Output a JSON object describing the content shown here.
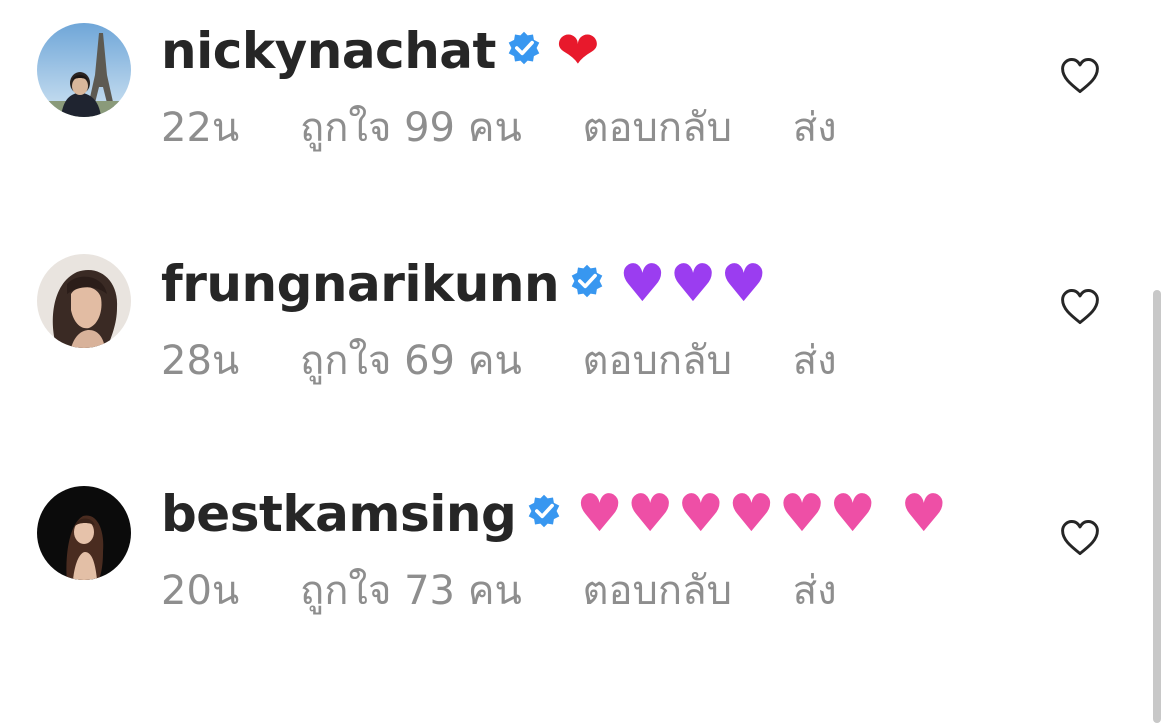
{
  "comments": [
    {
      "username": "nickynachat",
      "verified": true,
      "emoji": "❤",
      "emoji_name": "red-heart",
      "time": "22น",
      "likes": "ถูกใจ 99 คน",
      "reply": "ตอบกลับ",
      "send": "ส่ง"
    },
    {
      "username": "frungnarikunn",
      "verified": true,
      "emoji": "♥♥♥",
      "emoji_name": "purple-heart",
      "time": "28น",
      "likes": "ถูกใจ 69 คน",
      "reply": "ตอบกลับ",
      "send": "ส่ง"
    },
    {
      "username": "bestkamsing",
      "verified": true,
      "emoji": "♥♥♥♥♥♥ ♥",
      "emoji_name": "growing-heart",
      "time": "20น",
      "likes": "ถูกใจ 73 คน",
      "reply": "ตอบกลับ",
      "send": "ส่ง"
    }
  ],
  "colors": {
    "text": "#262626",
    "secondary": "#8e8e8e",
    "verified": "#3897f0",
    "red_heart": "#e8192c",
    "purple_heart": "#9b3df0",
    "pink_heart": "#ee4fa6"
  },
  "icons": {
    "like": "heart-outline-icon",
    "verified": "verified-badge-icon"
  }
}
